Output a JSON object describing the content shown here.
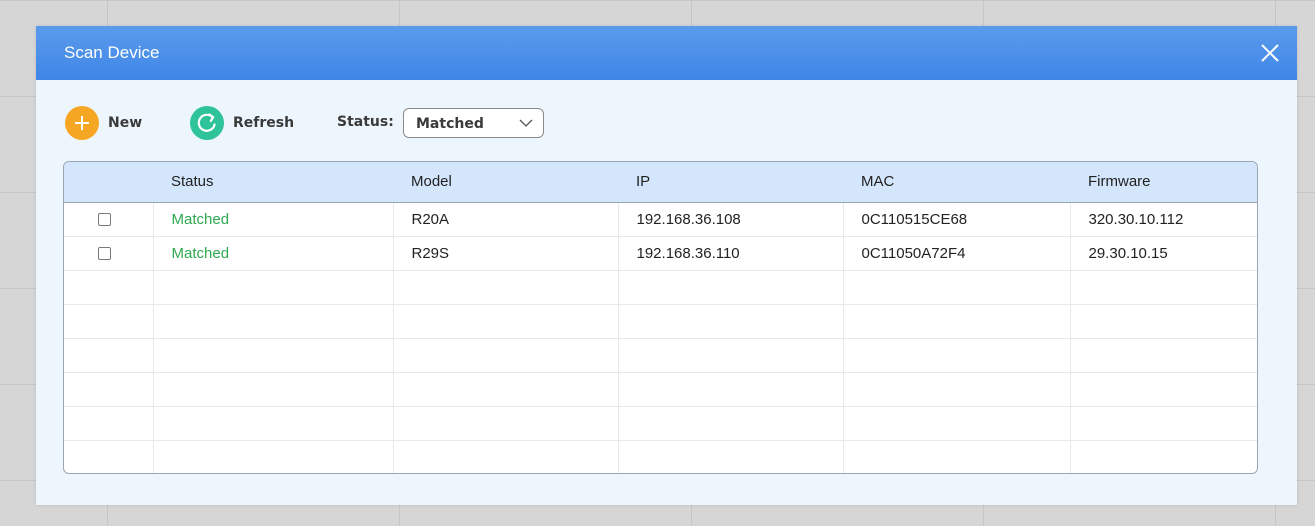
{
  "window": {
    "title": "Scan Device",
    "close_icon": "close-icon"
  },
  "toolbar": {
    "new_label": "New",
    "new_icon": "plus-icon",
    "refresh_label": "Refresh",
    "refresh_icon": "refresh-icon",
    "status_label": "Status:",
    "status_value": "Matched",
    "status_arrow_icon": "chevron-down-icon"
  },
  "colors": {
    "titlebar": "#3f86e8",
    "new_button": "#f5a623",
    "refresh_button": "#2fc39a",
    "matched_status": "#2fa84f",
    "table_header": "#d4e6fb"
  },
  "table": {
    "headers": [
      "",
      "Status",
      "Model",
      "IP",
      "MAC",
      "Firmware"
    ],
    "rows": [
      {
        "checked": false,
        "status": "Matched",
        "model": "R20A",
        "ip": "192.168.36.108",
        "mac": "0C110515CE68",
        "firmware": "320.30.10.112"
      },
      {
        "checked": false,
        "status": "Matched",
        "model": "R29S",
        "ip": "192.168.36.110",
        "mac": "0C11050A72F4",
        "firmware": "29.30.10.15"
      }
    ]
  }
}
